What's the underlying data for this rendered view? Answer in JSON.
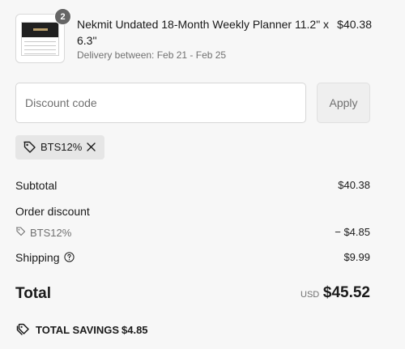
{
  "product": {
    "quantity": "2",
    "name": "Nekmit Undated 18-Month Weekly Planner 11.2\" x 6.3\"",
    "delivery": "Delivery between: Feb 21 - Feb 25",
    "price": "$40.38"
  },
  "discount": {
    "placeholder": "Discount code",
    "value": "",
    "apply_label": "Apply",
    "applied_code": "BTS12%"
  },
  "summary": {
    "subtotal_label": "Subtotal",
    "subtotal_value": "$40.38",
    "order_discount_label": "Order discount",
    "order_discount_code": "BTS12%",
    "order_discount_value": "− $4.85",
    "shipping_label": "Shipping",
    "shipping_value": "$9.99",
    "total_label": "Total",
    "currency": "USD",
    "total_value": "$45.52",
    "savings_label": "TOTAL SAVINGS",
    "savings_value": "$4.85"
  },
  "icons": {
    "tag": "tag-icon",
    "close": "close-icon",
    "help": "help-circle-icon",
    "savings": "double-tag-icon"
  },
  "colors": {
    "background": "#f7f7f7",
    "text": "#1a1a1a",
    "muted": "#707070",
    "chip": "#e6e6e6"
  }
}
